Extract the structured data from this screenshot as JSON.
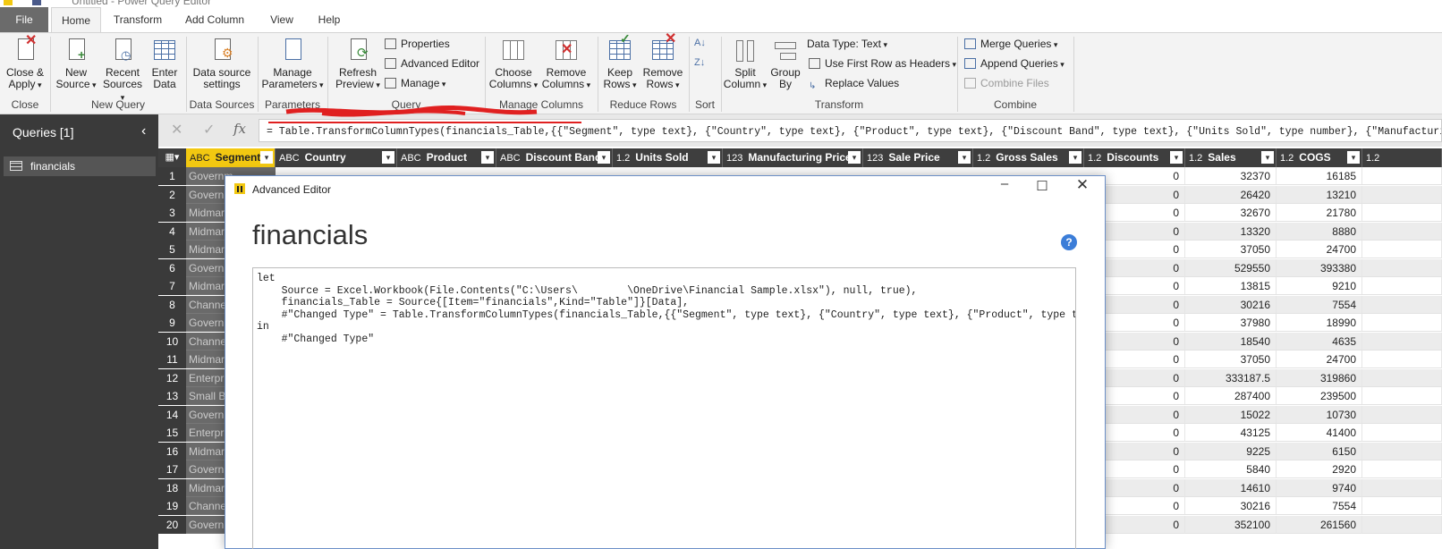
{
  "window": {
    "title": "Untitled - Power Query Editor"
  },
  "tabs": [
    {
      "label": "File"
    },
    {
      "label": "Home"
    },
    {
      "label": "Transform"
    },
    {
      "label": "Add Column"
    },
    {
      "label": "View"
    },
    {
      "label": "Help"
    }
  ],
  "ribbon": {
    "close_apply": {
      "line1": "Close &",
      "line2": "Apply"
    },
    "new_source": {
      "line1": "New",
      "line2": "Source"
    },
    "recent_sources": {
      "line1": "Recent",
      "line2": "Sources"
    },
    "enter_data": {
      "line1": "Enter",
      "line2": "Data"
    },
    "data_source_settings": {
      "line1": "Data source",
      "line2": "settings"
    },
    "manage_parameters": {
      "line1": "Manage",
      "line2": "Parameters"
    },
    "refresh_preview": {
      "line1": "Refresh",
      "line2": "Preview"
    },
    "properties": "Properties",
    "advanced_editor": "Advanced Editor",
    "manage": "Manage",
    "choose_columns": {
      "line1": "Choose",
      "line2": "Columns"
    },
    "remove_columns": {
      "line1": "Remove",
      "line2": "Columns"
    },
    "keep_rows": {
      "line1": "Keep",
      "line2": "Rows"
    },
    "remove_rows": {
      "line1": "Remove",
      "line2": "Rows"
    },
    "split_column": {
      "line1": "Split",
      "line2": "Column"
    },
    "group_by": {
      "line1": "Group",
      "line2": "By"
    },
    "data_type": "Data Type: Text",
    "use_first_row": "Use First Row as Headers",
    "replace_values": "Replace Values",
    "merge_queries": "Merge Queries",
    "append_queries": "Append Queries",
    "combine_files": "Combine Files",
    "groups": {
      "close": "Close",
      "new_query": "New Query",
      "data_sources": "Data Sources",
      "parameters": "Parameters",
      "query": "Query",
      "manage_columns": "Manage Columns",
      "reduce_rows": "Reduce Rows",
      "sort": "Sort",
      "transform": "Transform",
      "combine": "Combine"
    }
  },
  "queries_pane": {
    "title": "Queries [1]",
    "items": [
      {
        "label": "financials"
      }
    ]
  },
  "formula_bar": {
    "fx": "fx",
    "formula": "= Table.TransformColumnTypes(financials_Table,{{\"Segment\", type text}, {\"Country\", type text}, {\"Product\", type text}, {\"Discount Band\", type text}, {\"Units Sold\", type number}, {\"Manufacturing"
  },
  "grid": {
    "columns": [
      {
        "type": "ABC",
        "name": "Segment"
      },
      {
        "type": "ABC",
        "name": "Country"
      },
      {
        "type": "ABC",
        "name": "Product"
      },
      {
        "type": "ABC",
        "name": "Discount Band"
      },
      {
        "type": "1.2",
        "name": "Units Sold"
      },
      {
        "type": "123",
        "name": "Manufacturing Price"
      },
      {
        "type": "123",
        "name": "Sale Price"
      },
      {
        "type": "1.2",
        "name": "Gross Sales"
      },
      {
        "type": "1.2",
        "name": "Discounts"
      },
      {
        "type": "1.2",
        "name": "Sales"
      },
      {
        "type": "1.2",
        "name": "COGS"
      },
      {
        "type": "1.2",
        "name": ""
      }
    ],
    "rows": [
      {
        "n": "1",
        "segment": "Governm",
        "discounts": "0",
        "sales": "32370",
        "cogs": "16185"
      },
      {
        "n": "2",
        "segment": "Governm",
        "discounts": "0",
        "sales": "26420",
        "cogs": "13210"
      },
      {
        "n": "3",
        "segment": "Midmark",
        "discounts": "0",
        "sales": "32670",
        "cogs": "21780"
      },
      {
        "n": "4",
        "segment": "Midmark",
        "discounts": "0",
        "sales": "13320",
        "cogs": "8880"
      },
      {
        "n": "5",
        "segment": "Midmark",
        "discounts": "0",
        "sales": "37050",
        "cogs": "24700"
      },
      {
        "n": "6",
        "segment": "Governm",
        "discounts": "0",
        "sales": "529550",
        "cogs": "393380"
      },
      {
        "n": "7",
        "segment": "Midmark",
        "discounts": "0",
        "sales": "13815",
        "cogs": "9210"
      },
      {
        "n": "8",
        "segment": "Channel",
        "discounts": "0",
        "sales": "30216",
        "cogs": "7554"
      },
      {
        "n": "9",
        "segment": "Governm",
        "discounts": "0",
        "sales": "37980",
        "cogs": "18990"
      },
      {
        "n": "10",
        "segment": "Channel",
        "discounts": "0",
        "sales": "18540",
        "cogs": "4635"
      },
      {
        "n": "11",
        "segment": "Midmark",
        "discounts": "0",
        "sales": "37050",
        "cogs": "24700"
      },
      {
        "n": "12",
        "segment": "Enterpris",
        "discounts": "0",
        "sales": "333187.5",
        "cogs": "319860"
      },
      {
        "n": "13",
        "segment": "Small Bu",
        "discounts": "0",
        "sales": "287400",
        "cogs": "239500"
      },
      {
        "n": "14",
        "segment": "Governm",
        "discounts": "0",
        "sales": "15022",
        "cogs": "10730"
      },
      {
        "n": "15",
        "segment": "Enterpris",
        "discounts": "0",
        "sales": "43125",
        "cogs": "41400"
      },
      {
        "n": "16",
        "segment": "Midmark",
        "discounts": "0",
        "sales": "9225",
        "cogs": "6150"
      },
      {
        "n": "17",
        "segment": "Governm",
        "discounts": "0",
        "sales": "5840",
        "cogs": "2920"
      },
      {
        "n": "18",
        "segment": "Midmark",
        "discounts": "0",
        "sales": "14610",
        "cogs": "9740"
      },
      {
        "n": "19",
        "segment": "Channel",
        "discounts": "0",
        "sales": "30216",
        "cogs": "7554"
      },
      {
        "n": "20",
        "segment": "Governm",
        "discounts": "0",
        "sales": "352100",
        "cogs": "261560"
      }
    ]
  },
  "advanced_editor": {
    "title": "Advanced Editor",
    "heading": "financials",
    "help": "?",
    "code_lines": [
      "let",
      "    Source = Excel.Workbook(File.Contents(\"C:\\Users\\        \\OneDrive\\Financial Sample.xlsx\"), null, true),",
      "    financials_Table = Source{[Item=\"financials\",Kind=\"Table\"]}[Data],",
      "    #\"Changed Type\" = Table.TransformColumnTypes(financials_Table,{{\"Segment\", type text}, {\"Country\", type text}, {\"Product\", type text}, {\"Di",
      "in",
      "    #\"Changed Type\""
    ]
  },
  "colors": {
    "accent": "#f2c811",
    "pane_bg": "#3a3a3a",
    "dialog_border": "#6b8fc7",
    "redaction": "#e02020"
  }
}
